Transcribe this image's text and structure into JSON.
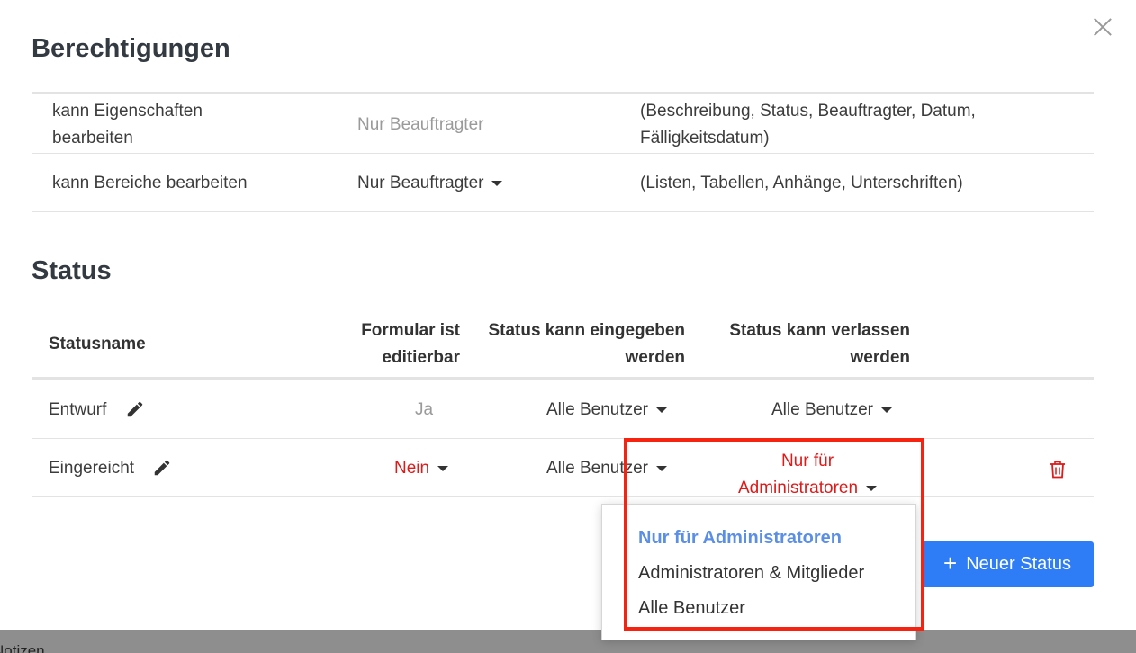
{
  "dialog": {
    "permissions_title": "Berechtigungen",
    "status_title": "Status"
  },
  "permissions": {
    "rows": [
      {
        "label_line1": "kann Eigenschaften",
        "label_line2": "bearbeiten",
        "value": "Nur Beauftragter",
        "note_line1": "(Beschreibung, Status, Beauftragter, Datum,",
        "note_line2": "Fälligkeitsdatum)"
      },
      {
        "label": "kann Bereiche bearbeiten",
        "value": "Nur Beauftragter",
        "note": "(Listen, Tabellen, Anhänge, Unterschriften)"
      }
    ]
  },
  "status_table": {
    "headers": {
      "name": "Statusname",
      "editable_line1": "Formular ist",
      "editable_line2": "editierbar",
      "enter_line1": "Status kann eingegeben",
      "enter_line2": "werden",
      "leave_line1": "Status kann verlassen",
      "leave_line2": "werden"
    },
    "rows": [
      {
        "name": "Entwurf",
        "editable": "Ja",
        "enter": "Alle Benutzer",
        "leave": "Alle Benutzer"
      },
      {
        "name": "Eingereicht",
        "editable": "Nein",
        "enter": "Alle Benutzer",
        "leave_line1": "Nur für",
        "leave_line2": "Administratoren"
      }
    ]
  },
  "dropdown": {
    "options": [
      "Nur für Administratoren",
      "Administratoren & Mitglieder",
      "Alle Benutzer"
    ],
    "selected_index": 0
  },
  "buttons": {
    "new_status": "Neuer Status"
  },
  "backdrop": {
    "text": "Notizen"
  },
  "colors": {
    "accent": "#2f7df6",
    "danger": "#e01919",
    "highlight": "#f5230f",
    "selected_option": "#5b8fe6"
  }
}
